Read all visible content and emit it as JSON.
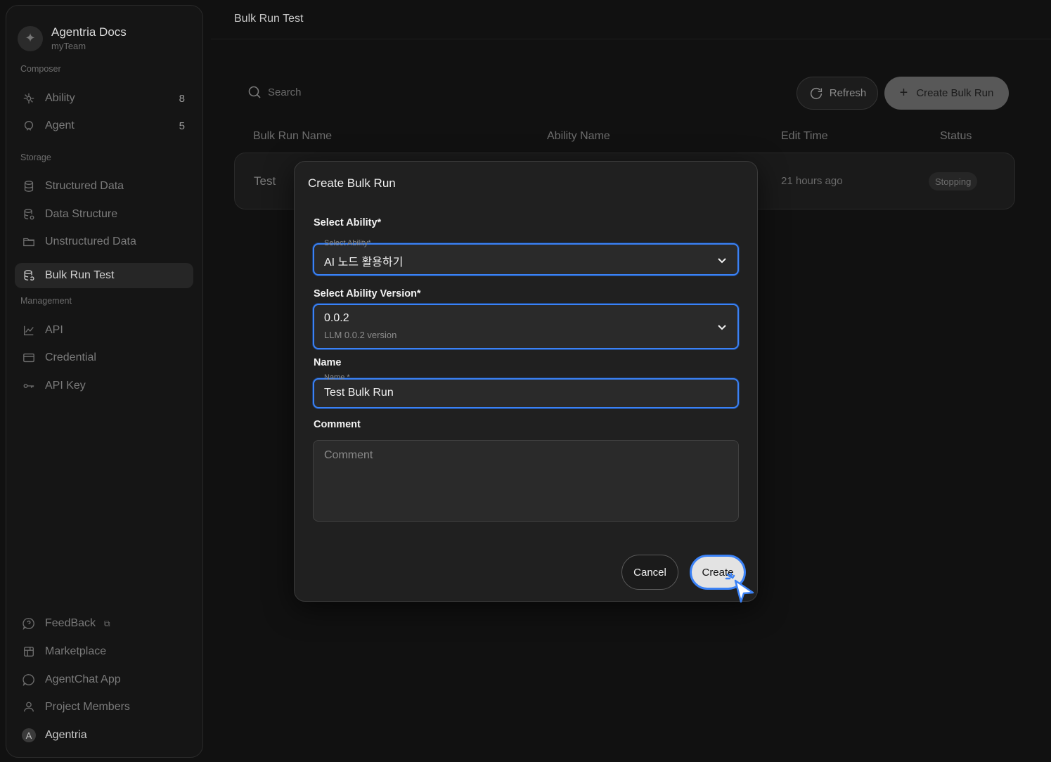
{
  "brand": {
    "title": "Agentria Docs",
    "team": "myTeam"
  },
  "sidebar": {
    "sections": {
      "composer": "Composer",
      "storage": "Storage",
      "management": "Management"
    },
    "items": [
      {
        "label": "Ability",
        "count": "8",
        "icon": "ability-icon"
      },
      {
        "label": "Agent",
        "count": "5",
        "icon": "agent-icon"
      },
      {
        "label": "Structured Data",
        "icon": "database-icon"
      },
      {
        "label": "Data Structure",
        "icon": "data-structure-icon"
      },
      {
        "label": "Unstructured Data",
        "icon": "folder-icon"
      },
      {
        "label": "Bulk Run Test",
        "icon": "bulk-run-icon",
        "active": true
      },
      {
        "label": "API",
        "icon": "chart-line-icon"
      },
      {
        "label": "Credential",
        "icon": "credit-card-icon"
      },
      {
        "label": "API Key",
        "icon": "key-icon"
      },
      {
        "label": "FeedBack",
        "icon": "help-bubble-icon"
      },
      {
        "label": "Marketplace",
        "icon": "marketplace-icon"
      },
      {
        "label": "AgentChat App",
        "icon": "chat-bubble-icon"
      },
      {
        "label": "Project Members",
        "icon": "person-icon"
      },
      {
        "label": "Agentria",
        "icon": "avatar-a",
        "avatar_letter": "A"
      }
    ]
  },
  "header": {
    "title": "Bulk Run Test"
  },
  "toolbar": {
    "search_placeholder": "Search",
    "refresh_label": "Refresh",
    "create_label": "Create Bulk Run"
  },
  "table": {
    "columns": [
      "Bulk Run Name",
      "Ability Name",
      "Edit Time",
      "Status"
    ],
    "rows": [
      {
        "name": "Test",
        "edit_time": "21 hours ago",
        "status": "Stopping"
      }
    ]
  },
  "modal": {
    "title": "Create Bulk Run",
    "ability": {
      "label": "Select Ability*",
      "float_label": "Select Ability*",
      "value": "AI 노드 활용하기"
    },
    "version": {
      "label": "Select Ability Version*",
      "value": "0.0.2",
      "sub": "LLM 0.0.2 version"
    },
    "name": {
      "label": "Name",
      "float_label": "Name *",
      "value": "Test Bulk Run"
    },
    "comment": {
      "label": "Comment",
      "placeholder": "Comment"
    },
    "cancel_label": "Cancel",
    "create_label": "Create"
  },
  "colors": {
    "accent": "#3b82f6",
    "background": "#111111"
  }
}
